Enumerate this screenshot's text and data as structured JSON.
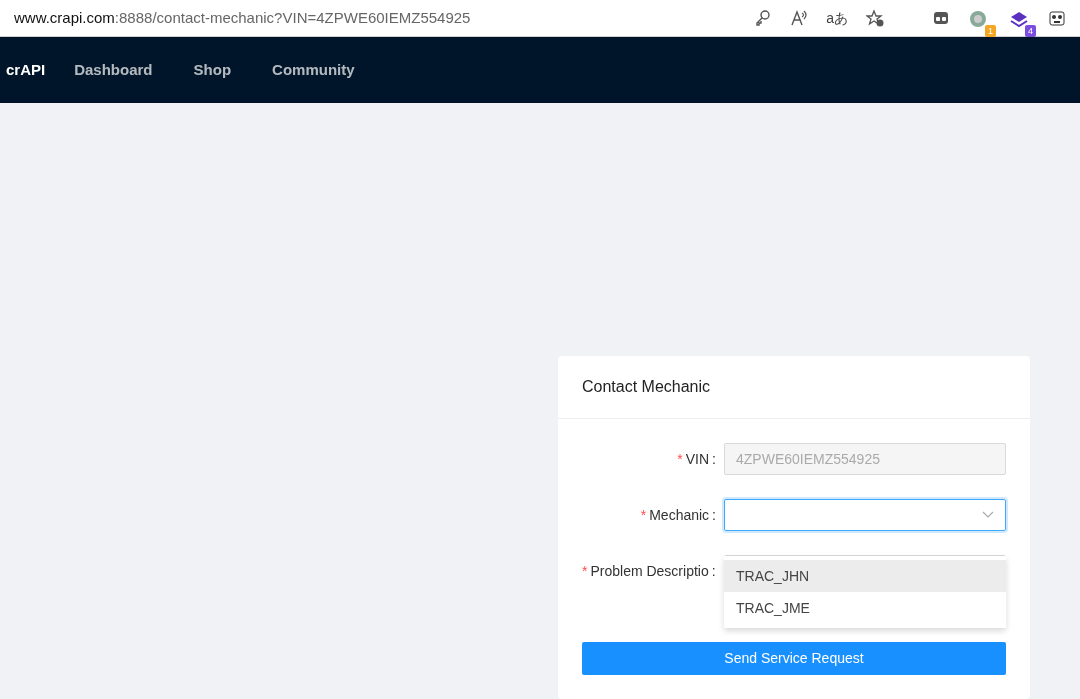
{
  "browser": {
    "url_host": "www.crapi.com",
    "url_rest": ":8888/contact-mechanic?VIN=4ZPWE60IEMZ554925",
    "translate_icon": "aあ",
    "extensions": [
      {
        "badge": "1",
        "color": "#f5a623"
      },
      {
        "badge": "4",
        "color": "#7b4ee0"
      }
    ]
  },
  "navbar": {
    "brand": "crAPI",
    "links": [
      "Dashboard",
      "Shop",
      "Community"
    ]
  },
  "card": {
    "title": "Contact Mechanic",
    "required_mark": "*",
    "separator": ":",
    "fields": [
      {
        "kind": "input",
        "label": "VIN",
        "required": true,
        "value": "4ZPWE60IEMZ554925",
        "disabled": true
      },
      {
        "kind": "select",
        "label": "Mechanic",
        "required": true,
        "focused": true
      },
      {
        "kind": "textarea",
        "label": "Problem Descriptio",
        "required": true
      }
    ],
    "dropdown": [
      {
        "label": "TRAC_JHN",
        "selected": true
      },
      {
        "label": "TRAC_JME",
        "selected": false
      }
    ],
    "submit": "Send Service Request"
  }
}
